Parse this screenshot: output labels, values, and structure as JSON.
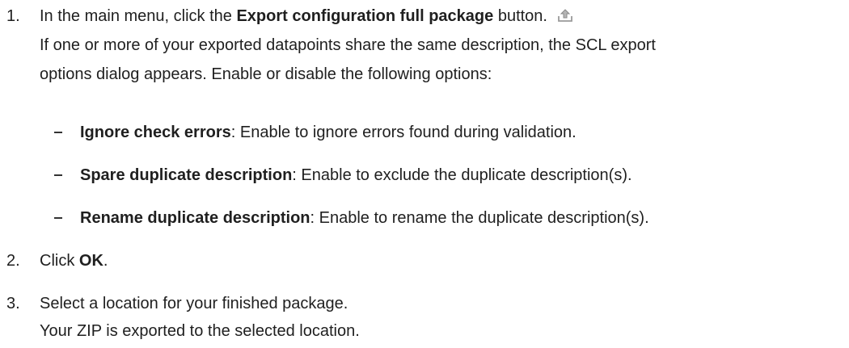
{
  "steps": [
    {
      "number": "1.",
      "prefix": "In the main menu, click the ",
      "bold": "Export configuration full package",
      "suffix": " button.",
      "icon": "export-icon",
      "description_line1": "If one or more of your exported datapoints share the same description, the SCL export",
      "description_line2": "options dialog appears. Enable or disable the following options:",
      "options": [
        {
          "name": "Ignore check errors",
          "text": ": Enable to ignore errors found during validation."
        },
        {
          "name": "Spare duplicate description",
          "text": ": Enable to exclude the duplicate description(s)."
        },
        {
          "name": "Rename duplicate description",
          "text": ": Enable to rename the duplicate description(s)."
        }
      ]
    },
    {
      "number": "2.",
      "prefix": "Click ",
      "bold": "OK",
      "suffix": "."
    },
    {
      "number": "3.",
      "text": "Select a location for your finished package.",
      "result": "Your ZIP is exported to the selected location."
    }
  ]
}
